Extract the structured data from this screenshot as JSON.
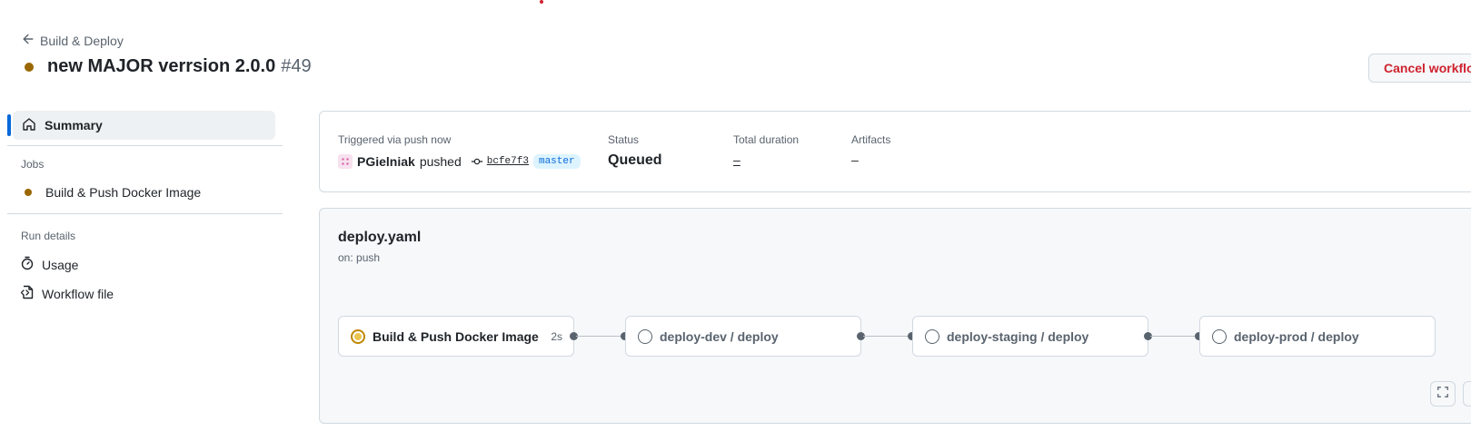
{
  "header": {
    "back_label": "Build & Deploy",
    "run_title": "new MAJOR verrsion 2.0.0",
    "run_number": "#49",
    "cancel_label": "Cancel workflow"
  },
  "sidebar": {
    "summary_label": "Summary",
    "jobs_heading": "Jobs",
    "jobs": [
      {
        "label": "Build & Push Docker Image",
        "status": "queued"
      }
    ],
    "run_details_heading": "Run details",
    "run_details": [
      {
        "label": "Usage",
        "icon": "stopwatch-icon"
      },
      {
        "label": "Workflow file",
        "icon": "file-code-icon"
      }
    ]
  },
  "summary": {
    "triggered_label": "Triggered via push now",
    "user": "PGielniak",
    "action": "pushed",
    "commit": "bcfe7f3",
    "branch": "master",
    "status_label": "Status",
    "status_value": "Queued",
    "duration_label": "Total duration",
    "duration_value": "–",
    "artifacts_label": "Artifacts",
    "artifacts_value": "–"
  },
  "workflow": {
    "file": "deploy.yaml",
    "trigger": "on: push",
    "jobs": [
      {
        "name": "Build & Push Docker Image",
        "duration": "2s",
        "status": "queued"
      },
      {
        "name": "deploy-dev / deploy",
        "status": "pending"
      },
      {
        "name": "deploy-staging / deploy",
        "status": "pending"
      },
      {
        "name": "deploy-prod / deploy",
        "status": "pending"
      }
    ]
  },
  "colors": {
    "queued": "#9a6700",
    "accent": "#0969da",
    "danger": "#cf222e"
  }
}
